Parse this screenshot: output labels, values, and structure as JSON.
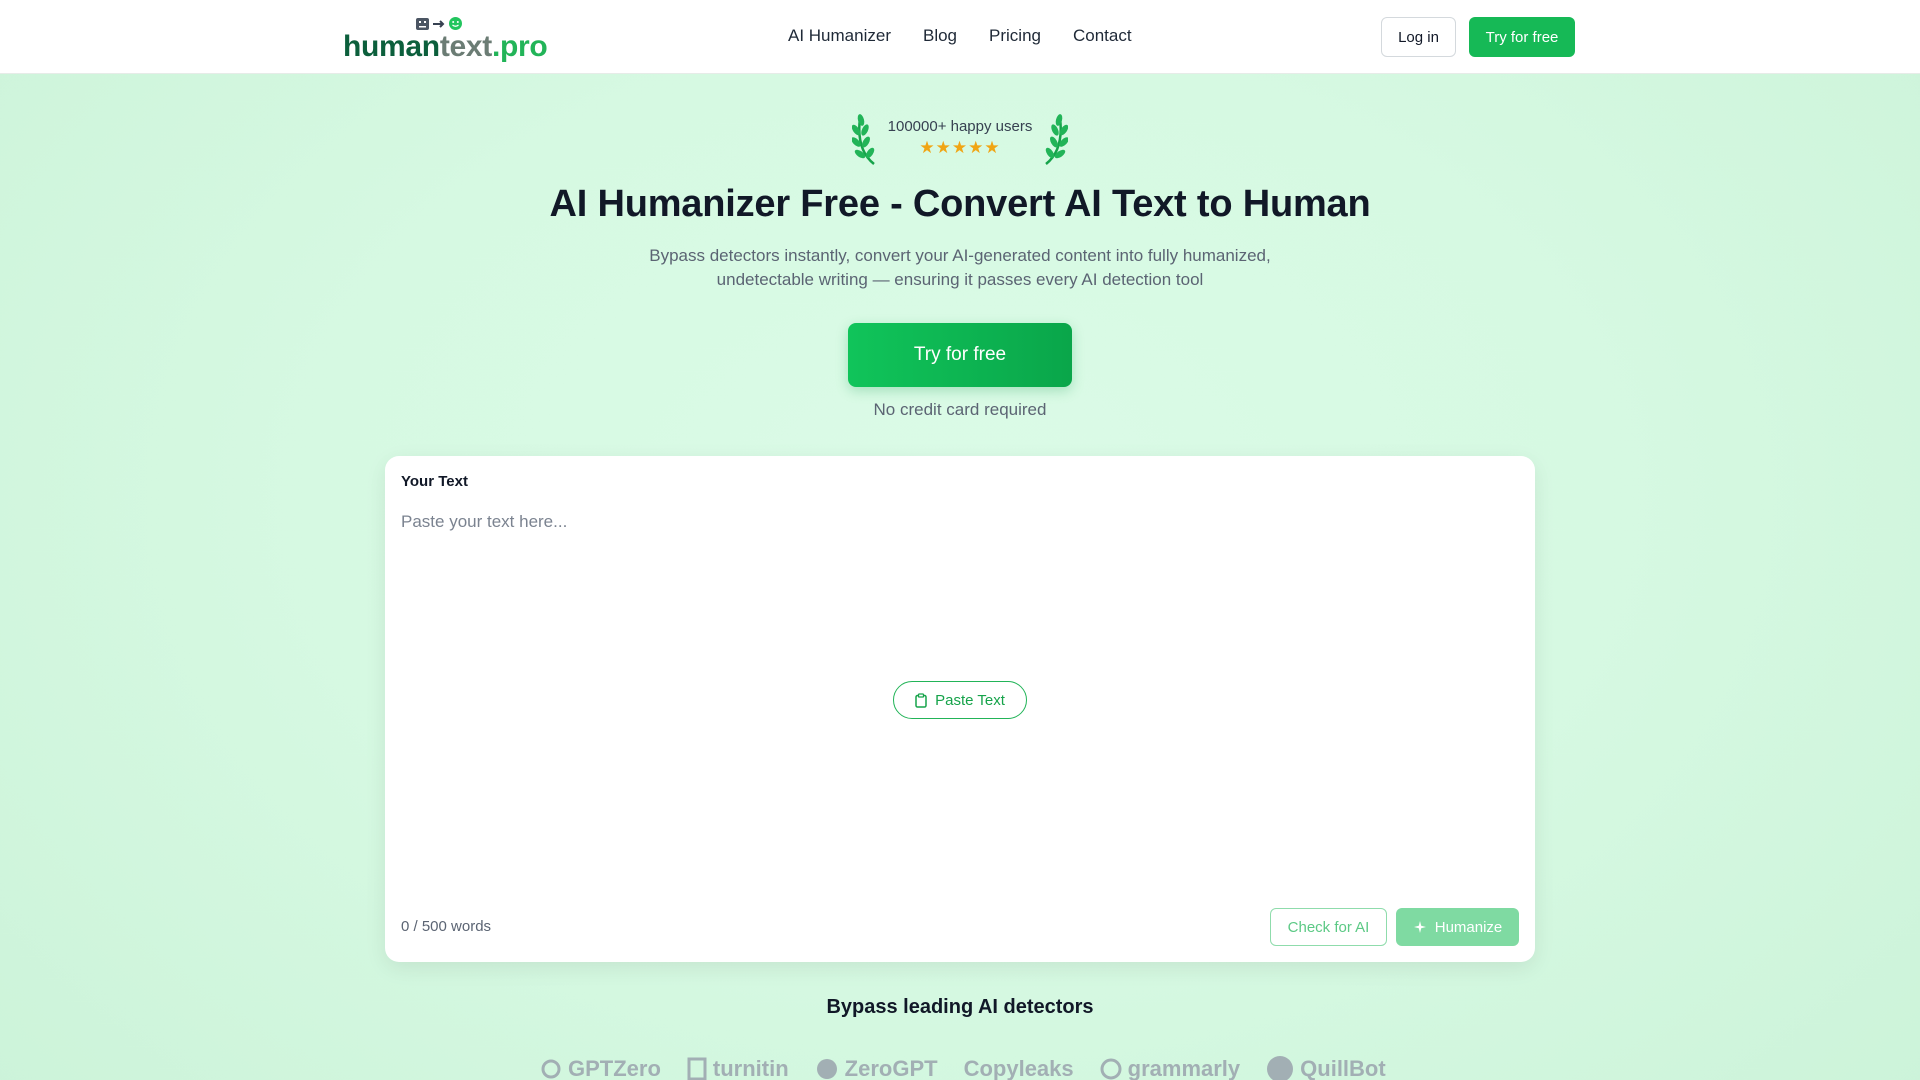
{
  "header": {
    "logo": {
      "part1": "human",
      "part2": "text",
      "part3": ".pro"
    },
    "nav": [
      {
        "label": "AI Humanizer"
      },
      {
        "label": "Blog"
      },
      {
        "label": "Pricing"
      },
      {
        "label": "Contact"
      }
    ],
    "login_label": "Log in",
    "try_label": "Try for free"
  },
  "hero": {
    "badge_text": "100000+ happy users",
    "stars": "★★★★★",
    "title": "AI Humanizer Free - Convert AI Text to Human",
    "subtitle": "Bypass detectors instantly, convert your AI-generated content into fully humanized, undetectable writing — ensuring it passes every AI detection tool",
    "cta_label": "Try for free",
    "no_cc": "No credit card required"
  },
  "editor": {
    "label": "Your Text",
    "placeholder": "Paste your text here...",
    "paste_label": "Paste Text",
    "word_count": "0 / 500 words",
    "check_label": "Check for AI",
    "humanize_label": "Humanize"
  },
  "detectors": {
    "title": "Bypass leading AI detectors",
    "logos": [
      "GPTZero",
      "turnitin",
      "ZeroGPT",
      "Copyleaks",
      "grammarly",
      "QuillBot"
    ]
  },
  "colors": {
    "brand_green": "#16b956",
    "dark_green": "#0c5f3c",
    "star": "#f0a514"
  }
}
